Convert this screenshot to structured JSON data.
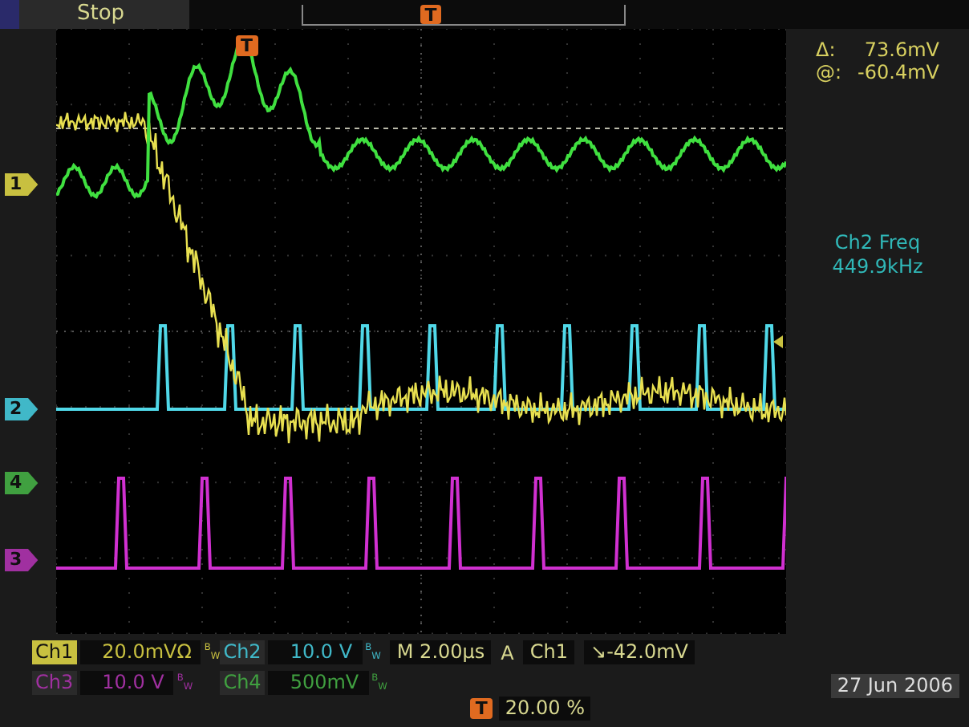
{
  "status": "Stop",
  "top_trigger_marker": "T",
  "graticule_trigger_marker": "T",
  "cursor_readout": {
    "delta_label": "Δ:",
    "delta_value": "73.6mV",
    "at_label": "@:",
    "at_value": "-60.4mV"
  },
  "measurement": {
    "label": "Ch2 Freq",
    "value": "449.9kHz"
  },
  "channel_markers": [
    {
      "label": "1",
      "color": "#c8c040"
    },
    {
      "label": "2",
      "color": "#40b8c8"
    },
    {
      "label": "4",
      "color": "#40a040"
    },
    {
      "label": "3",
      "color": "#a030a0"
    }
  ],
  "channels": [
    {
      "name": "Ch1",
      "scale": "20.0mVΩ",
      "bw": "$^{B}$$_{W}$",
      "color": "#c8c040",
      "selected": true
    },
    {
      "name": "Ch2",
      "scale": "10.0 V",
      "bw": "$^{B}$$_{W}$",
      "color": "#40b8c8",
      "selected": false
    },
    {
      "name": "Ch3",
      "scale": "10.0 V",
      "bw": "$^{B}$$_{W}$",
      "color": "#a030a0",
      "selected": false
    },
    {
      "name": "Ch4",
      "scale": "500mV",
      "bw": "$^{B}$$_{W}$",
      "color": "#40a040",
      "selected": false
    }
  ],
  "timebase": "M 2.00µs",
  "trigger": {
    "mode": "A",
    "source": "Ch1",
    "slope": "↘",
    "level": "-42.0mV"
  },
  "trigger_position": {
    "marker": "T",
    "value": "20.00 %"
  },
  "date": "27 Jun  2006"
}
